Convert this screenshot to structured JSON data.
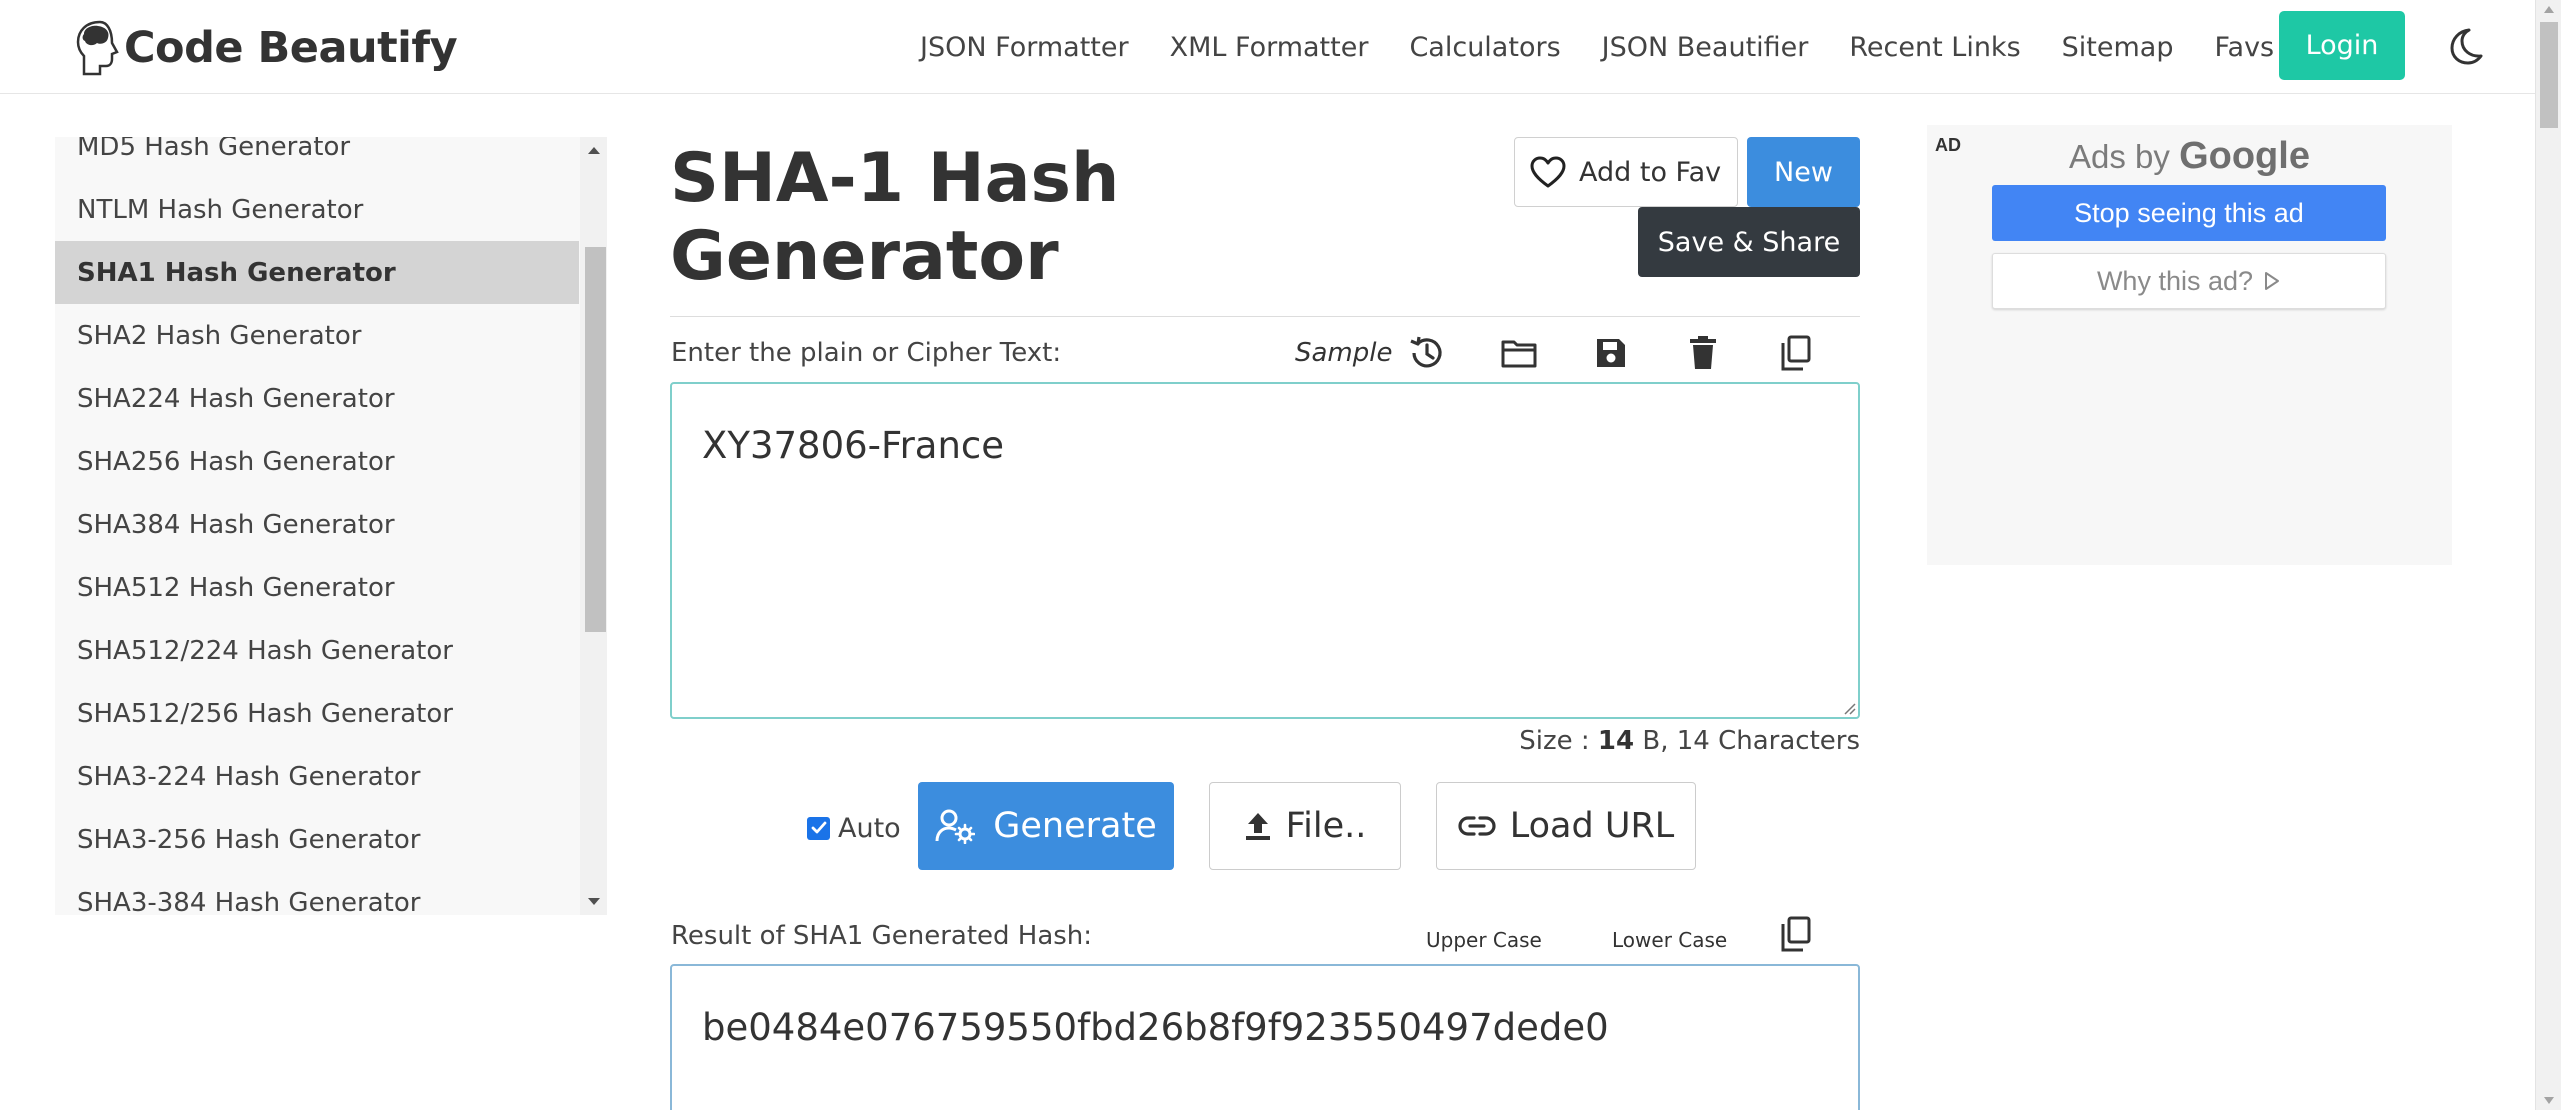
{
  "brand": {
    "name": "Code Beautify"
  },
  "nav": {
    "links": [
      "JSON Formatter",
      "XML Formatter",
      "Calculators",
      "JSON Beautifier",
      "Recent Links",
      "Sitemap"
    ],
    "favs": "Favs",
    "login": "Login"
  },
  "sidebar": {
    "items": [
      {
        "label": "MD5 Hash Generator",
        "active": false
      },
      {
        "label": "NTLM Hash Generator",
        "active": false
      },
      {
        "label": "SHA1 Hash Generator",
        "active": true
      },
      {
        "label": "SHA2 Hash Generator",
        "active": false
      },
      {
        "label": "SHA224 Hash Generator",
        "active": false
      },
      {
        "label": "SHA256 Hash Generator",
        "active": false
      },
      {
        "label": "SHA384 Hash Generator",
        "active": false
      },
      {
        "label": "SHA512 Hash Generator",
        "active": false
      },
      {
        "label": "SHA512/224 Hash Generator",
        "active": false
      },
      {
        "label": "SHA512/256 Hash Generator",
        "active": false
      },
      {
        "label": "SHA3-224 Hash Generator",
        "active": false
      },
      {
        "label": "SHA3-256 Hash Generator",
        "active": false
      },
      {
        "label": "SHA3-384 Hash Generator",
        "active": false
      }
    ]
  },
  "main": {
    "title_line1": "SHA-1 Hash",
    "title_line2": "Generator",
    "add_to_fav": "Add to Fav",
    "new": "New",
    "save_share": "Save & Share",
    "input_label": "Enter the plain or Cipher Text:",
    "sample": "Sample",
    "input_value": "XY37806-France",
    "size_prefix": "Size : ",
    "size_bytes": "14",
    "size_suffix": " B, 14 Characters",
    "auto_label": "Auto",
    "auto_checked": true,
    "generate": "Generate",
    "file": "File..",
    "load_url": "Load URL",
    "result_label": "Result of SHA1 Generated Hash:",
    "upper_case": "Upper Case",
    "lower_case": "Lower Case",
    "result_value": "be0484e076759550fbd26b8f9f923550497dede0"
  },
  "ad": {
    "badge": "AD",
    "ads_by": "Ads by",
    "google": "Google",
    "stop": "Stop seeing this ad",
    "why": "Why this ad?"
  },
  "icons": {
    "history": "history-icon",
    "open": "folder-icon",
    "save": "save-icon",
    "delete": "trash-icon",
    "copy": "copy-icon",
    "theme": "moon-icon",
    "favs_dropdown": "chevron-down-icon",
    "fav": "heart-icon",
    "generate": "user-gear-icon",
    "file": "upload-icon",
    "load_url": "link-icon",
    "why_ad": "play-outline-icon"
  },
  "colors": {
    "login": "#1ec8a5",
    "primary_button": "#3c8dde",
    "save_share": "#343a40",
    "active_sidebar": "#d4d4d4",
    "input_border": "#7fcfcb",
    "ad_blue": "#4285f4",
    "favs_chevron": "#3c5bd6"
  }
}
